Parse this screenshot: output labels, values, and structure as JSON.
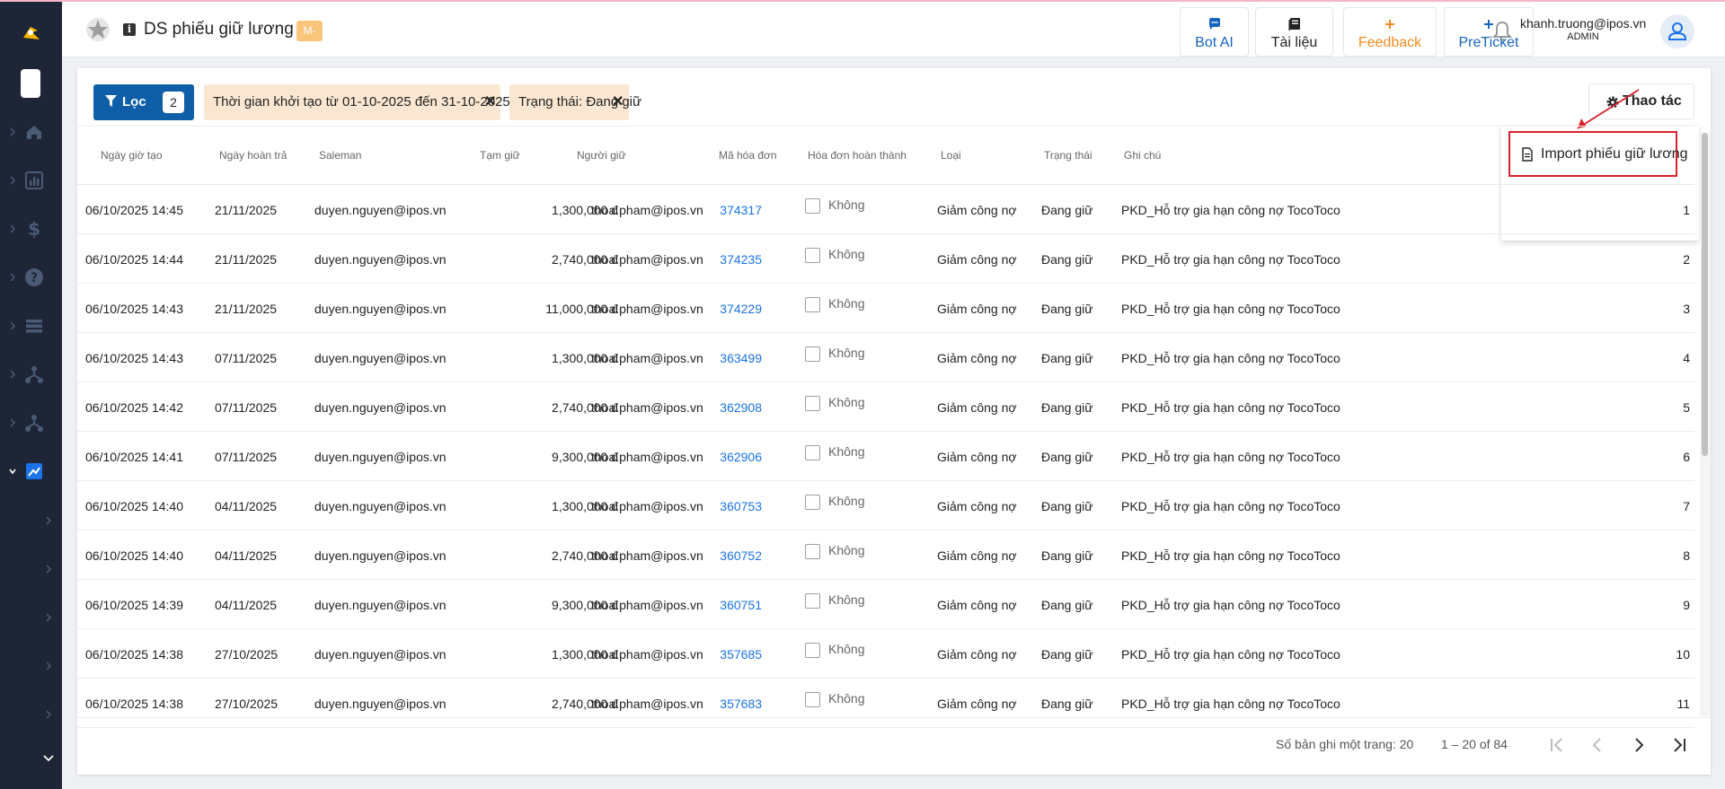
{
  "header": {
    "title": "DS phiếu giữ lương",
    "badge": "M-",
    "buttons": [
      {
        "label": "Bot AI",
        "icon": "chat-bubble-icon",
        "color": "#1565c0"
      },
      {
        "label": "Tài liệu",
        "icon": "book-icon",
        "color": "#222222"
      },
      {
        "label": "Feedback",
        "icon": "plus-icon",
        "color": "#f5891f"
      },
      {
        "label": "PreTicket",
        "icon": "plus-icon",
        "color": "#1565c0"
      }
    ],
    "user": {
      "email": "khanh.truong@ipos.vn",
      "role": "ADMIN"
    }
  },
  "filters": {
    "filter_label": "Lọc",
    "filter_count": "2",
    "chips": [
      {
        "text": "Thời gian khởi tạo từ 01-10-2025 đến 31-10-2025"
      },
      {
        "text": "Trạng thái: Đang giữ"
      }
    ]
  },
  "actions": {
    "label": "Thao tác",
    "menu_item": "Import phiếu giữ lương"
  },
  "table": {
    "columns": [
      "Ngày giờ tạo",
      "Ngày hoàn trả",
      "Saleman",
      "Tạm giữ",
      "Người giữ",
      "Mã hóa đơn",
      "Hóa đơn hoàn thành",
      "Loại",
      "Trạng thái",
      "Ghi chú"
    ],
    "rows": [
      {
        "created": "06/10/2025 14:45",
        "due": "21/11/2025",
        "saleman": "duyen.nguyen@ipos.vn",
        "amount": "1,300,000 đ",
        "holder": "thoa.pham@ipos.vn",
        "invoice": "374317",
        "done": "Không",
        "type": "Giảm công nợ",
        "status": "Đang giữ",
        "note": "PKD_Hỗ trợ gia hạn công nợ TocoToco",
        "no": "1"
      },
      {
        "created": "06/10/2025 14:44",
        "due": "21/11/2025",
        "saleman": "duyen.nguyen@ipos.vn",
        "amount": "2,740,000 đ",
        "holder": "thoa.pham@ipos.vn",
        "invoice": "374235",
        "done": "Không",
        "type": "Giảm công nợ",
        "status": "Đang giữ",
        "note": "PKD_Hỗ trợ gia hạn công nợ TocoToco",
        "no": "2"
      },
      {
        "created": "06/10/2025 14:43",
        "due": "21/11/2025",
        "saleman": "duyen.nguyen@ipos.vn",
        "amount": "11,000,000 đ",
        "holder": "thoa.pham@ipos.vn",
        "invoice": "374229",
        "done": "Không",
        "type": "Giảm công nợ",
        "status": "Đang giữ",
        "note": "PKD_Hỗ trợ gia hạn công nợ TocoToco",
        "no": "3"
      },
      {
        "created": "06/10/2025 14:43",
        "due": "07/11/2025",
        "saleman": "duyen.nguyen@ipos.vn",
        "amount": "1,300,000 đ",
        "holder": "thoa.pham@ipos.vn",
        "invoice": "363499",
        "done": "Không",
        "type": "Giảm công nợ",
        "status": "Đang giữ",
        "note": "PKD_Hỗ trợ gia hạn công nợ TocoToco",
        "no": "4"
      },
      {
        "created": "06/10/2025 14:42",
        "due": "07/11/2025",
        "saleman": "duyen.nguyen@ipos.vn",
        "amount": "2,740,000 đ",
        "holder": "thoa.pham@ipos.vn",
        "invoice": "362908",
        "done": "Không",
        "type": "Giảm công nợ",
        "status": "Đang giữ",
        "note": "PKD_Hỗ trợ gia hạn công nợ TocoToco",
        "no": "5"
      },
      {
        "created": "06/10/2025 14:41",
        "due": "07/11/2025",
        "saleman": "duyen.nguyen@ipos.vn",
        "amount": "9,300,000 đ",
        "holder": "thoa.pham@ipos.vn",
        "invoice": "362906",
        "done": "Không",
        "type": "Giảm công nợ",
        "status": "Đang giữ",
        "note": "PKD_Hỗ trợ gia hạn công nợ TocoToco",
        "no": "6"
      },
      {
        "created": "06/10/2025 14:40",
        "due": "04/11/2025",
        "saleman": "duyen.nguyen@ipos.vn",
        "amount": "1,300,000 đ",
        "holder": "thoa.pham@ipos.vn",
        "invoice": "360753",
        "done": "Không",
        "type": "Giảm công nợ",
        "status": "Đang giữ",
        "note": "PKD_Hỗ trợ gia hạn công nợ TocoToco",
        "no": "7"
      },
      {
        "created": "06/10/2025 14:40",
        "due": "04/11/2025",
        "saleman": "duyen.nguyen@ipos.vn",
        "amount": "2,740,000 đ",
        "holder": "thoa.pham@ipos.vn",
        "invoice": "360752",
        "done": "Không",
        "type": "Giảm công nợ",
        "status": "Đang giữ",
        "note": "PKD_Hỗ trợ gia hạn công nợ TocoToco",
        "no": "8"
      },
      {
        "created": "06/10/2025 14:39",
        "due": "04/11/2025",
        "saleman": "duyen.nguyen@ipos.vn",
        "amount": "9,300,000 đ",
        "holder": "thoa.pham@ipos.vn",
        "invoice": "360751",
        "done": "Không",
        "type": "Giảm công nợ",
        "status": "Đang giữ",
        "note": "PKD_Hỗ trợ gia hạn công nợ TocoToco",
        "no": "9"
      },
      {
        "created": "06/10/2025 14:38",
        "due": "27/10/2025",
        "saleman": "duyen.nguyen@ipos.vn",
        "amount": "1,300,000 đ",
        "holder": "thoa.pham@ipos.vn",
        "invoice": "357685",
        "done": "Không",
        "type": "Giảm công nợ",
        "status": "Đang giữ",
        "note": "PKD_Hỗ trợ gia hạn công nợ TocoToco",
        "no": "10"
      },
      {
        "created": "06/10/2025 14:38",
        "due": "27/10/2025",
        "saleman": "duyen.nguyen@ipos.vn",
        "amount": "2,740,000 đ",
        "holder": "thoa.pham@ipos.vn",
        "invoice": "357683",
        "done": "Không",
        "type": "Giảm công nợ",
        "status": "Đang giữ",
        "note": "PKD_Hỗ trợ gia hạn công nợ TocoToco",
        "no": "11"
      }
    ]
  },
  "pagination": {
    "per_page": "Số bản ghi một trang: 20",
    "range": "1 – 20 of 84"
  },
  "colors": {
    "sidebar": "#1d2536",
    "primary": "#0f5fa8",
    "chip": "#fbe7d1",
    "link": "#1a73e8",
    "highlight": "#d9212d"
  }
}
